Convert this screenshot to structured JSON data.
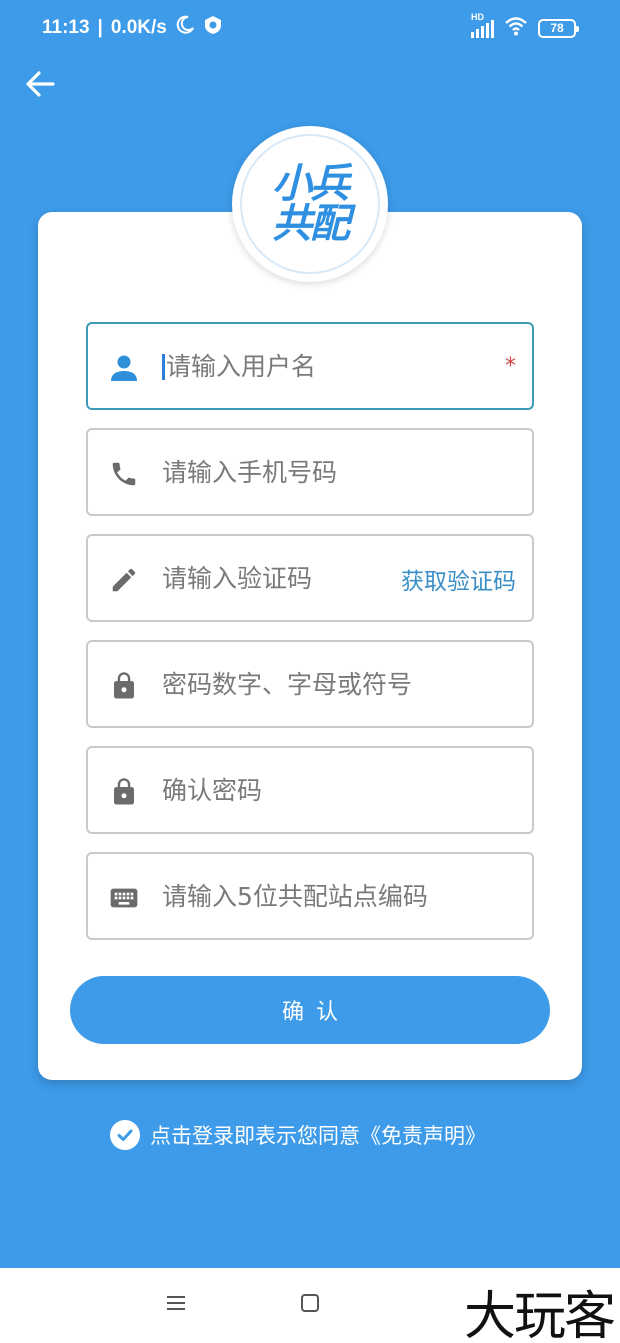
{
  "status_bar": {
    "time": "11:13",
    "speed": "0.0K/s",
    "battery": "78",
    "network": "HD"
  },
  "logo": {
    "line1": "小兵",
    "line2": "共配"
  },
  "form": {
    "username_placeholder": "请输入用户名",
    "required_mark": "*",
    "phone_placeholder": "请输入手机号码",
    "code_placeholder": "请输入验证码",
    "get_code_label": "获取验证码",
    "password_placeholder": "密码数字、字母或符号",
    "confirm_password_placeholder": "确认密码",
    "station_code_placeholder": "请输入5位共配站点编码",
    "confirm_label": "确认"
  },
  "agreement": {
    "text": "点击登录即表示您同意《免责声明》"
  },
  "watermark": "大玩客",
  "colors": {
    "primary": "#3d9be9",
    "required": "#d64545",
    "link": "#3a8fc7"
  }
}
